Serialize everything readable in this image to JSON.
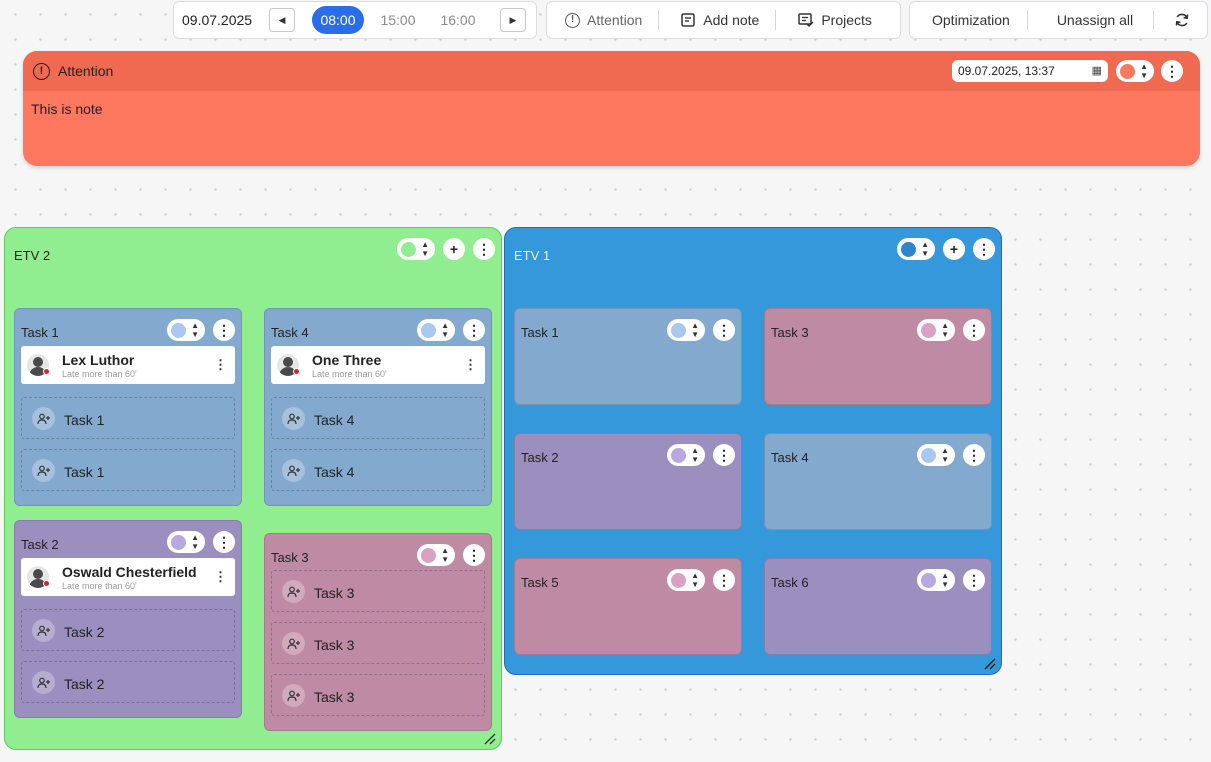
{
  "toolbar": {
    "date": "09.07.2025",
    "prev_icon": "chevron-left-icon",
    "next_icon": "chevron-right-icon",
    "times": [
      "08:00",
      "15:00",
      "16:00"
    ],
    "selected_time": "08:00",
    "attention_label": "Attention",
    "add_note_label": "Add note",
    "projects_label": "Projects",
    "optimization_label": "Optimization",
    "unassign_all_label": "Unassign all",
    "refresh_icon": "refresh-icon"
  },
  "attention_panel": {
    "title": "Attention",
    "icon": "alert-circle-icon",
    "datetime": "09.07.2025, 13:37",
    "note": "This is note",
    "color_toggle": "#fe7860",
    "header_color": "#ef6a51"
  },
  "etvs": [
    {
      "title": "ETV 2",
      "color": "#90ee90",
      "border": "#5cc95c",
      "toggle_color": "#90ee90",
      "tasks": [
        {
          "title": "Task 1",
          "color": "#84a9cf",
          "toggle_color": "#a9c7ef",
          "person": {
            "name": "Lex Luthor",
            "status": "Late more than 60'"
          },
          "slots": [
            "Task 1",
            "Task 1"
          ]
        },
        {
          "title": "Task 4",
          "color": "#84a9cf",
          "toggle_color": "#a9c7ef",
          "person": {
            "name": "One Three",
            "status": "Late more than 60'"
          },
          "slots": [
            "Task 4",
            "Task 4"
          ]
        },
        {
          "title": "Task 2",
          "color": "#9a8fbf",
          "toggle_color": "#b7a8e0",
          "person": {
            "name": "Oswald Chesterfield",
            "status": "Late more than 60'"
          },
          "slots": [
            "Task 2",
            "Task 2"
          ]
        },
        {
          "title": "Task 3",
          "color": "#bf8aa3",
          "toggle_color": "#d9a2c4",
          "person": null,
          "slots": [
            "Task 3",
            "Task 3",
            "Task 3"
          ]
        }
      ]
    },
    {
      "title": "ETV 1",
      "color": "#3498db",
      "border": "#1f6fb0",
      "toggle_color": "#2f86d0",
      "tasks": [
        {
          "title": "Task 1",
          "color": "#84a9cf",
          "toggle_color": "#a9c7ef"
        },
        {
          "title": "Task 3",
          "color": "#bf8aa3",
          "toggle_color": "#d9a2c4"
        },
        {
          "title": "Task 2",
          "color": "#9a8fbf",
          "toggle_color": "#b7a8e0"
        },
        {
          "title": "Task 4",
          "color": "#84a9cf",
          "toggle_color": "#a9c7ef"
        },
        {
          "title": "Task 5",
          "color": "#bf8aa3",
          "toggle_color": "#d9a2c4"
        },
        {
          "title": "Task 6",
          "color": "#9a8fbf",
          "toggle_color": "#b7a8e0"
        }
      ]
    }
  ]
}
